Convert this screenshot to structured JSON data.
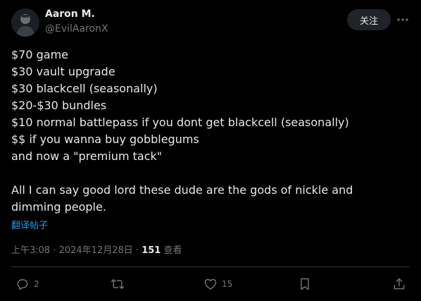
{
  "author": {
    "display_name": "Aaron M.",
    "handle": "@EvilAaronX",
    "avatar_icon": "avatar-icon"
  },
  "header": {
    "follow_label": "关注",
    "more_icon": "more-icon"
  },
  "tweet": {
    "lines": [
      "$70 game",
      "$30 vault upgrade",
      "$30 blackcell (seasonally)",
      "$20-$30 bundles",
      "$10 normal battlepass if you dont get blackcell (seasonally)",
      "$$ if you wanna buy gobblegums",
      "and now a \"premium tack\""
    ],
    "closing": "All I can say good lord these dude are the gods of nickle and dimming people."
  },
  "translate_label": "翻译帖子",
  "meta": {
    "time": "上午3:08",
    "separator": " · ",
    "date": "2024年12月28日",
    "views_count": "151",
    "views_label": " 查看"
  },
  "actions": {
    "reply_count": "2",
    "retweet_count": "",
    "like_count": "15",
    "bookmark_count": ""
  },
  "colors": {
    "background": "#000000",
    "text_primary": "#e7e9ea",
    "text_secondary": "#71767b",
    "link": "#1d9bf0",
    "divider": "#2f3336",
    "follow_button_bg": "#202327"
  }
}
